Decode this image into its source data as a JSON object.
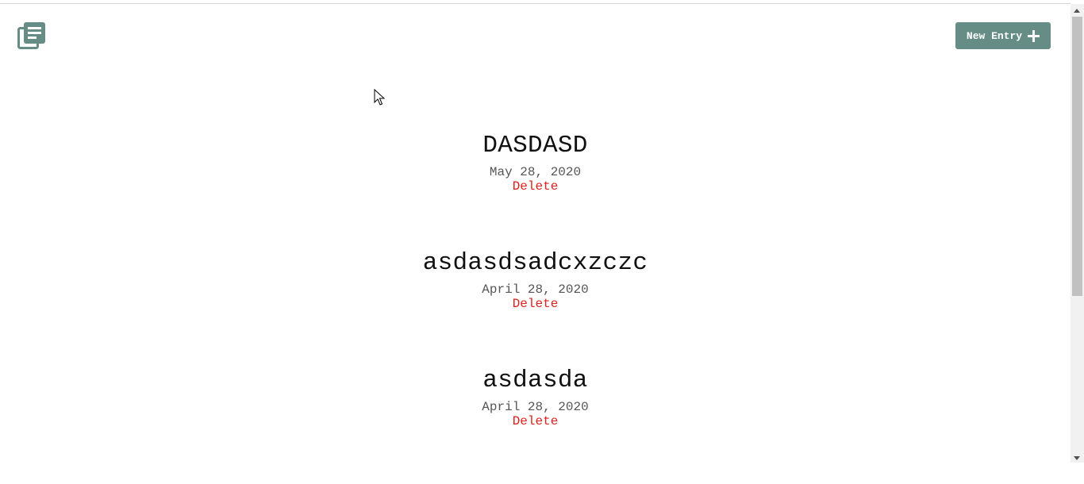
{
  "header": {
    "logo_icon": "book-stack-icon",
    "new_entry_label": "New Entry",
    "new_entry_icon": "plus-icon"
  },
  "entries": [
    {
      "title": "DASDASD",
      "date": "May 28, 2020",
      "delete_label": "Delete"
    },
    {
      "title": "asdasdsadcxzczc",
      "date": "April 28, 2020",
      "delete_label": "Delete"
    },
    {
      "title": "asdasda",
      "date": "April 28, 2020",
      "delete_label": "Delete"
    }
  ],
  "colors": {
    "accent": "#668d85",
    "delete": "#e0201c",
    "title": "#111111",
    "date": "#555555"
  }
}
